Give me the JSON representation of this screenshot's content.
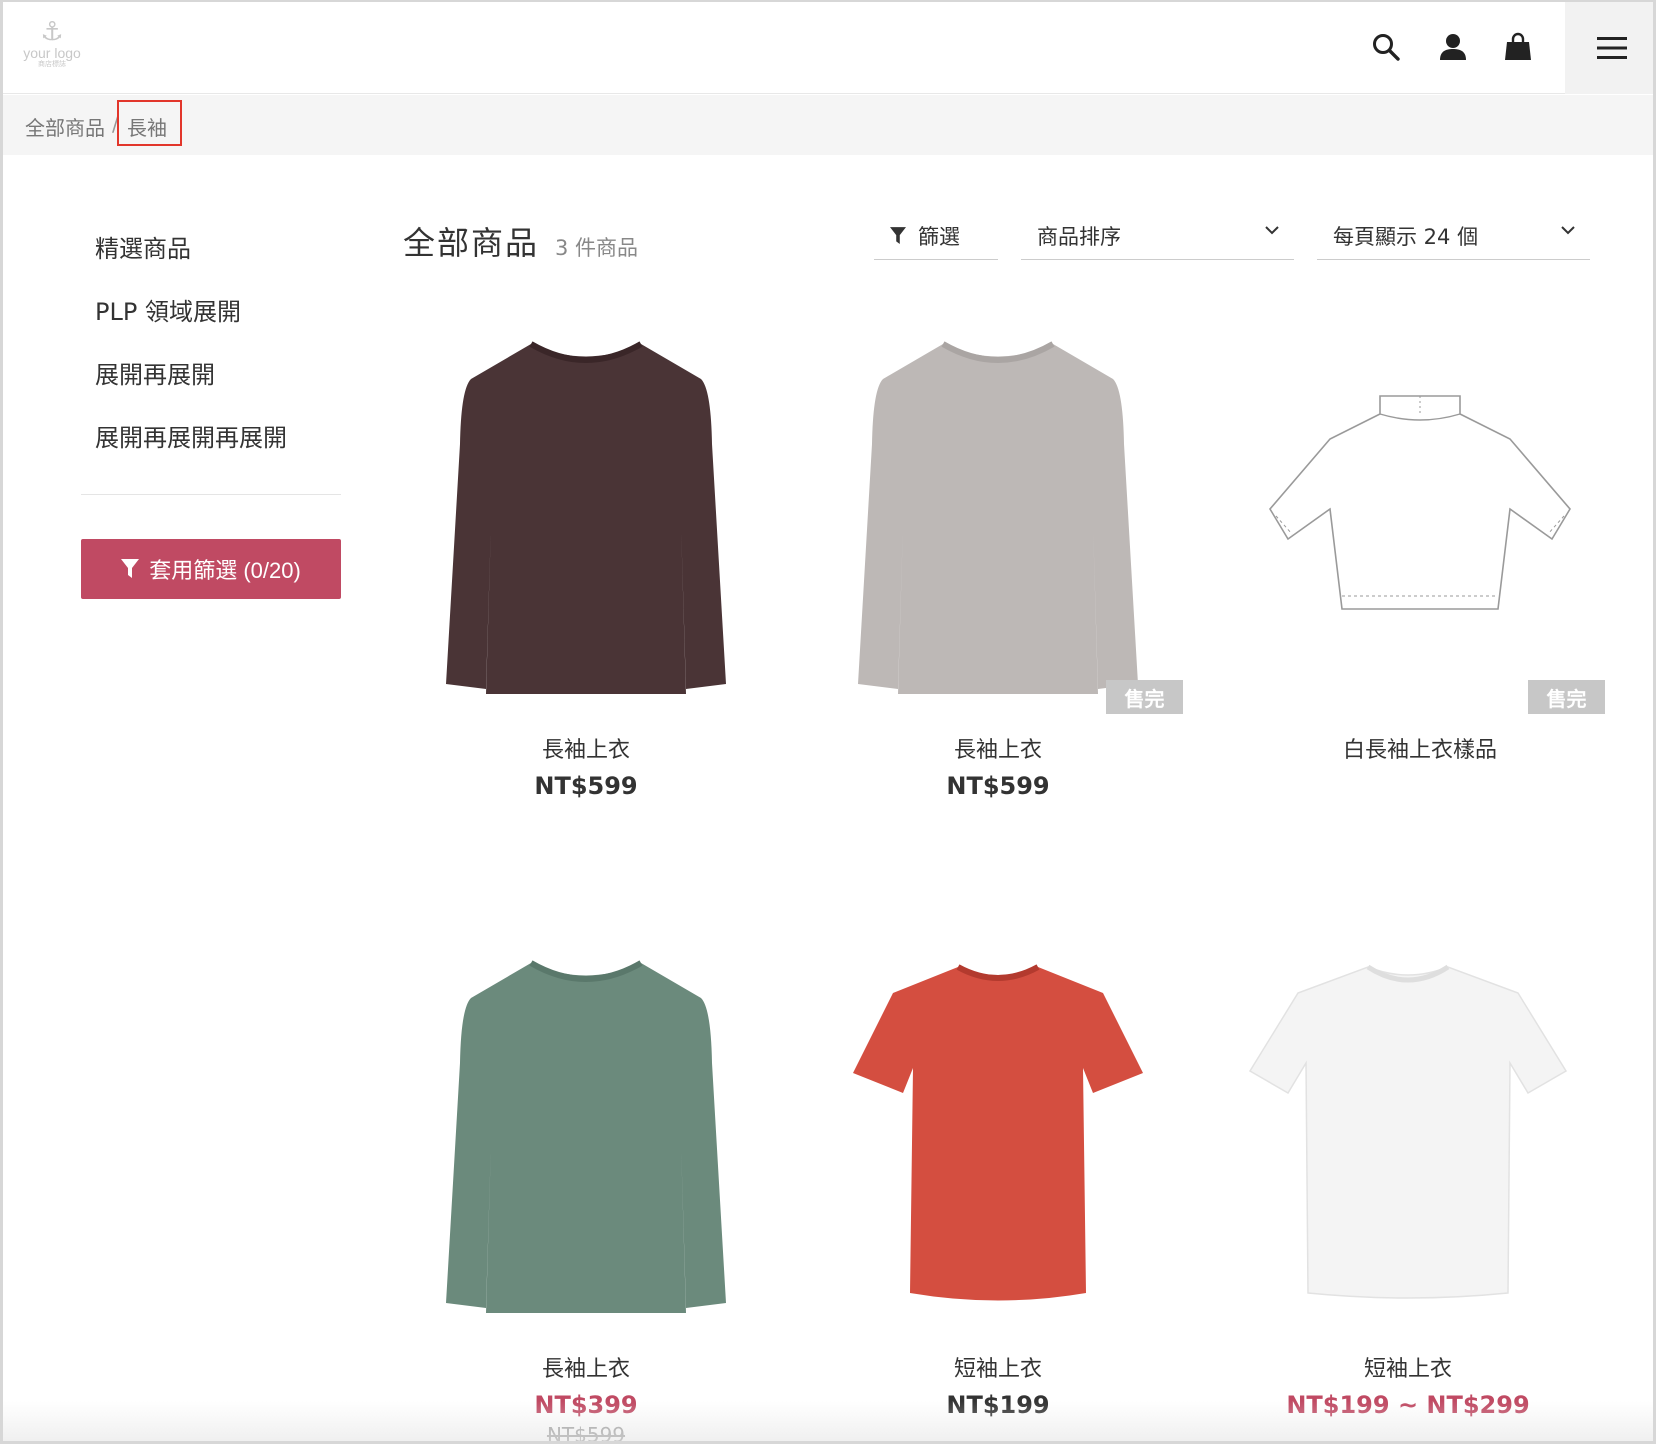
{
  "header": {
    "logo_text": "your logo",
    "logo_sub": "商店標誌",
    "icons": [
      "search-icon",
      "user-icon",
      "shopping-bag-icon",
      "menu-icon"
    ]
  },
  "breadcrumb": {
    "root": "全部商品",
    "separator": "/",
    "current": "長袖"
  },
  "sidebar": {
    "items": [
      {
        "label": "精選商品"
      },
      {
        "label": "PLP 領域展開"
      },
      {
        "label": "展開再展開"
      },
      {
        "label": "展開再展開再展開"
      }
    ],
    "apply_label": "套用篩選 (0/20)",
    "accent_color": "#c04a63"
  },
  "main": {
    "title": "全部商品",
    "count": "3 件商品",
    "filter_label": "篩選",
    "sort_label": "商品排序",
    "per_page_label": "每頁顯示 24 個"
  },
  "products": [
    {
      "name": "長袖上衣",
      "price": "NT$599",
      "sold_out": false,
      "color": "#4a3436",
      "style": "longsleeve"
    },
    {
      "name": "長袖上衣",
      "price": "NT$599",
      "sold_out": true,
      "soldout_label": "售完",
      "color": "#bdb8b6",
      "style": "longsleeve"
    },
    {
      "name": "白長袖上衣樣品",
      "price": "",
      "sold_out": true,
      "soldout_label": "售完",
      "color": "#ffffff",
      "style": "sketch"
    },
    {
      "name": "長袖上衣",
      "price": "NT$399",
      "old_price": "NT$599",
      "sale": true,
      "sold_out": false,
      "color": "#6b8a7c",
      "style": "longsleeve"
    },
    {
      "name": "短袖上衣",
      "price": "NT$199",
      "sold_out": false,
      "color": "#d44e40",
      "style": "shortsleeve"
    },
    {
      "name": "短袖上衣",
      "price": "NT$199 ~ NT$299",
      "sale": true,
      "sold_out": false,
      "color": "#f4f4f4",
      "style": "shortsleeve"
    }
  ]
}
